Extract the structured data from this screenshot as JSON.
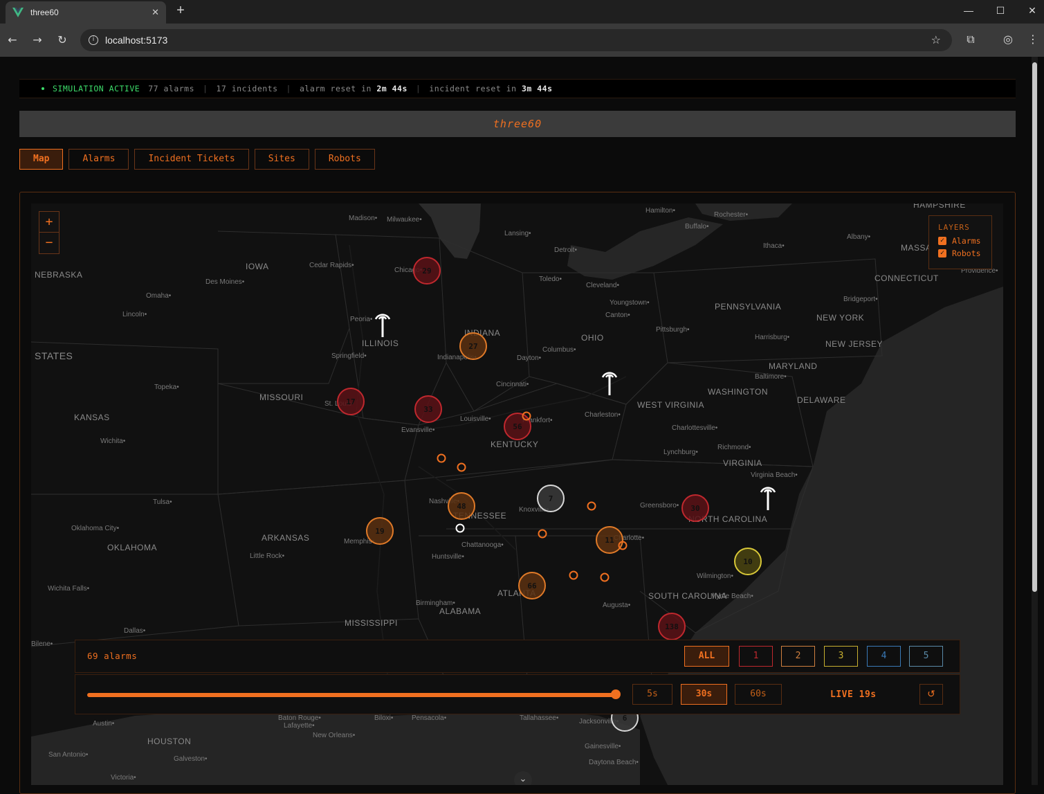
{
  "browser": {
    "tab_title": "three60",
    "url": "localhost:5173",
    "new_tab": "+",
    "tab_close": "✕"
  },
  "status": {
    "active_label": "SIMULATION ACTIVE",
    "alarms": "77 alarms",
    "incidents": "17 incidents",
    "alarm_reset_prefix": "alarm reset in",
    "alarm_reset_time": "2m 44s",
    "incident_reset_prefix": "incident reset in",
    "incident_reset_time": "3m 44s"
  },
  "app": {
    "title": "three60"
  },
  "nav": {
    "tabs": [
      {
        "label": "Map",
        "active": true
      },
      {
        "label": "Alarms",
        "active": false
      },
      {
        "label": "Incident Tickets",
        "active": false
      },
      {
        "label": "Sites",
        "active": false
      },
      {
        "label": "Robots",
        "active": false
      }
    ]
  },
  "map": {
    "zoom_in": "+",
    "zoom_out": "−",
    "layers": {
      "title": "LAYERS",
      "items": [
        {
          "label": "Alarms",
          "checked": true
        },
        {
          "label": "Robots",
          "checked": true
        }
      ]
    },
    "states": [
      "NEBRASKA",
      "IOWA",
      "ILLINOIS",
      "INDIANA",
      "OHIO",
      "PENNSYLVANIA",
      "NEW YORK",
      "MISSOURI",
      "KANSAS",
      "KENTUCKY",
      "WEST VIRGINIA",
      "VIRGINIA",
      "MARYLAND",
      "DELAWARE",
      "NEW JERSEY",
      "CONNECTICUT",
      "TENNESSEE",
      "NORTH CAROLINA",
      "SOUTH CAROLINA",
      "ARKANSAS",
      "OKLAHOMA",
      "MISSISSIPPI",
      "ALABAMA",
      "STATES",
      "HOUSTON",
      "MASSACH",
      "HAMPSHIRE",
      "WASHINGTON",
      "ATLANTA"
    ],
    "cities": [
      "Madison",
      "Milwaukee",
      "Lansing",
      "Detroit",
      "Hamilton",
      "Rochester",
      "Buffalo",
      "Albany",
      "Ithaca",
      "Cedar Rapids",
      "Des Moines",
      "Omaha",
      "Lincoln",
      "Chicago",
      "Peoria",
      "Springfield",
      "Indianapolis",
      "Toledo",
      "Cleveland",
      "Youngstown",
      "Canton",
      "Pittsburgh",
      "Columbus",
      "Dayton",
      "Bridgeport",
      "Harrisburg",
      "Baltimore",
      "Topeka",
      "St. Louis",
      "Cincinnati",
      "Charleston",
      "Charlottesville",
      "Louisville",
      "Frankfort",
      "Evansville",
      "Wichita",
      "Richmond",
      "Lynchburg",
      "Virginia Beach",
      "Nashville",
      "Knoxville",
      "Greensboro",
      "Tulsa",
      "Oklahoma City",
      "Memphis",
      "Little Rock",
      "Chattanooga",
      "Huntsville",
      "Charlotte",
      "Wilmington",
      "Myrtle Beach",
      "Wichita Falls",
      "Birmingham",
      "Augusta",
      "Dallas",
      "Baton Rouge",
      "Lafayette",
      "Biloxi",
      "Pensacola",
      "Tallahassee",
      "Jacksonville",
      "New Orleans",
      "Austin",
      "Galveston",
      "San Antonio",
      "Gainesville",
      "Daytona Beach",
      "Victoria",
      "Providence",
      "Bilene"
    ],
    "clusters": [
      {
        "count": "29",
        "tone": "red"
      },
      {
        "count": "27",
        "tone": "orange"
      },
      {
        "count": "17",
        "tone": "red"
      },
      {
        "count": "33",
        "tone": "red"
      },
      {
        "count": "56",
        "tone": "red"
      },
      {
        "count": "7",
        "tone": "gray"
      },
      {
        "count": "48",
        "tone": "orange"
      },
      {
        "count": "19",
        "tone": "orange"
      },
      {
        "count": "11",
        "tone": "orange"
      },
      {
        "count": "30",
        "tone": "red"
      },
      {
        "count": "10",
        "tone": "yellow"
      },
      {
        "count": "66",
        "tone": "orange"
      },
      {
        "count": "138",
        "tone": "red"
      },
      {
        "count": "6",
        "tone": "gray"
      }
    ],
    "robot_icon": "robot-antenna-icon"
  },
  "filter": {
    "count_label": "69 alarms",
    "buttons": [
      {
        "label": "ALL",
        "color": "#f07020",
        "active": true
      },
      {
        "label": "1",
        "color": "#c0282e"
      },
      {
        "label": "2",
        "color": "#d08040"
      },
      {
        "label": "3",
        "color": "#c8b030"
      },
      {
        "label": "4",
        "color": "#3a7ab8"
      },
      {
        "label": "5",
        "color": "#5a8aa8"
      }
    ]
  },
  "timeline": {
    "progress": 1.0,
    "windows": [
      {
        "label": "5s",
        "active": false
      },
      {
        "label": "30s",
        "active": true
      },
      {
        "label": "60s",
        "active": false
      }
    ],
    "live_label": "LIVE 19s",
    "reset_icon": "↺"
  }
}
